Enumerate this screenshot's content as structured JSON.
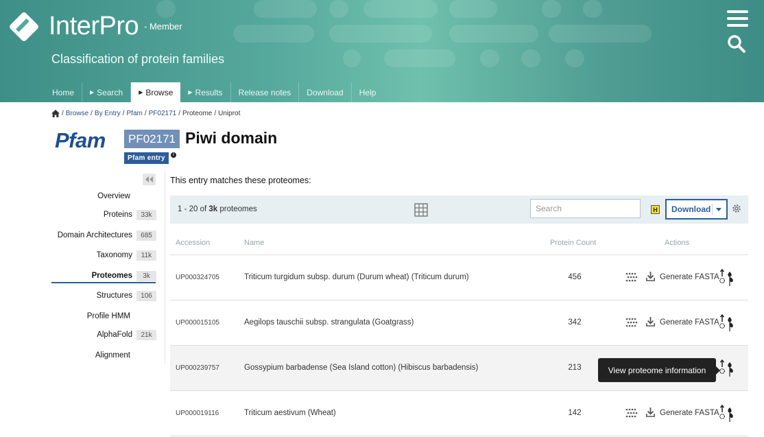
{
  "header": {
    "logo_text": "InterPro",
    "logo_sub": "- Member",
    "tagline": "Classification of protein families",
    "menu_icon": "hamburger-menu-icon",
    "search_icon": "search-icon"
  },
  "nav": {
    "items": [
      {
        "label": "Home"
      },
      {
        "label": "Search"
      },
      {
        "label": "Browse"
      },
      {
        "label": "Results"
      },
      {
        "label": "Release notes"
      },
      {
        "label": "Download"
      },
      {
        "label": "Help"
      }
    ],
    "active": "Browse"
  },
  "breadcrumb": {
    "items": [
      "Browse",
      "By Entry",
      "Pfam",
      "PF02171",
      "Proteome",
      "Uniprot"
    ]
  },
  "entry": {
    "db_logo": "Pfam",
    "accession": "PF02171",
    "title": "Piwi domain",
    "badge": "Pfam entry"
  },
  "sidebar": {
    "items": [
      {
        "label": "Overview",
        "count": ""
      },
      {
        "label": "Proteins",
        "count": "33k"
      },
      {
        "label": "Domain Architectures",
        "count": "685"
      },
      {
        "label": "Taxonomy",
        "count": "11k"
      },
      {
        "label": "Proteomes",
        "count": "3k"
      },
      {
        "label": "Structures",
        "count": "106"
      },
      {
        "label": "Profile HMM",
        "count": ""
      },
      {
        "label": "AlphaFold",
        "count": "21k"
      },
      {
        "label": "Alignment",
        "count": ""
      }
    ],
    "active": "Proteomes"
  },
  "main": {
    "intro": "This entry matches these proteomes:",
    "toolbar": {
      "range": "1 - 20 of ",
      "total": "3k",
      "unit": " proteomes",
      "search_placeholder": "Search",
      "h_label": "H",
      "download_label": "Download"
    },
    "table": {
      "columns": [
        "Accession",
        "Name",
        "Protein Count",
        "Actions"
      ],
      "rows": [
        {
          "accession": "UP000324705",
          "name": "Triticum turgidum subsp. durum (Durum wheat) (Triticum durum)",
          "count": "456",
          "fasta": "Generate FASTA"
        },
        {
          "accession": "UP000015105",
          "name": "Aegilops tauschii subsp. strangulata (Goatgrass)",
          "count": "342",
          "fasta": "Generate FASTA"
        },
        {
          "accession": "UP000239757",
          "name": "Gossypium barbadense (Sea Island cotton) (Hibiscus barbadensis)",
          "count": "213",
          "fasta": "Generate FASTA"
        },
        {
          "accession": "UP000019116",
          "name": "Triticum aestivum (Wheat)",
          "count": "142",
          "fasta": "Generate FASTA"
        }
      ]
    },
    "tooltip": "View proteome information"
  },
  "colors": {
    "brand_blue": "#2d5d98",
    "accession_bg": "#7290b6",
    "header_teal": "#55a89c"
  }
}
